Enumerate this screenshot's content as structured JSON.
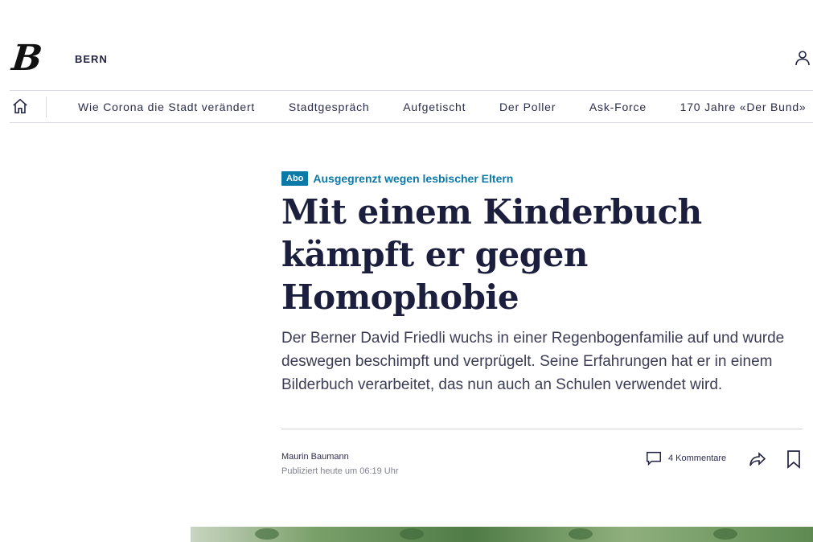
{
  "header": {
    "logo_letter": "B",
    "section": "BERN",
    "icons": {
      "user": "user-icon",
      "home": "home-icon"
    }
  },
  "nav": {
    "items": [
      "Wie Corona die Stadt verändert",
      "Stadtgespräch",
      "Aufgetischt",
      "Der Poller",
      "Ask-Force",
      "170 Jahre «Der Bund»"
    ]
  },
  "article": {
    "badge": "Abo",
    "kicker": "Ausgegrenzt wegen lesbischer Eltern",
    "headline": "Mit einem Kinderbuch kämpft er gegen Homophobie",
    "lead": "Der Berner David Friedli wuchs in einer Regenbogenfamilie auf und wurde deswegen beschimpft und verprügelt. Seine Erfahrungen hat er in einem Bilderbuch verarbeitet, das nun auch an Schulen verwendet wird.",
    "author": "Maurin Baumann",
    "published": "Publiziert heute um 06:19 Uhr",
    "comments_label": "4 Kommentare"
  },
  "colors": {
    "accent": "#0b7aa8",
    "headline": "#1b1e3c",
    "text": "#3a3d55"
  }
}
